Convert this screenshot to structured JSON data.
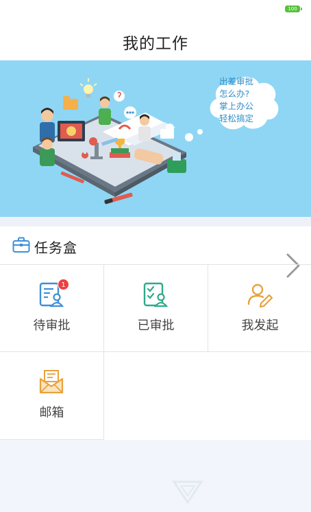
{
  "status_bar": {
    "battery": "100"
  },
  "header": {
    "title": "我的工作"
  },
  "banner": {
    "cloud_lines": [
      "出差审批",
      "怎么办?",
      "掌上办公",
      "轻松搞定"
    ]
  },
  "task_box": {
    "title": "任务盒",
    "tiles": [
      {
        "label": "待审批",
        "icon": "pending-approval-icon",
        "badge": "1"
      },
      {
        "label": "已审批",
        "icon": "approved-icon"
      },
      {
        "label": "我发起",
        "icon": "initiated-icon"
      },
      {
        "label": "邮箱",
        "icon": "mailbox-icon"
      }
    ]
  },
  "colors": {
    "banner_bg": "#8fd6f5",
    "icon_blue": "#3d8fd6",
    "icon_green": "#2eaa8a",
    "icon_orange": "#e8a23c",
    "badge_red": "#ef3f3f"
  }
}
